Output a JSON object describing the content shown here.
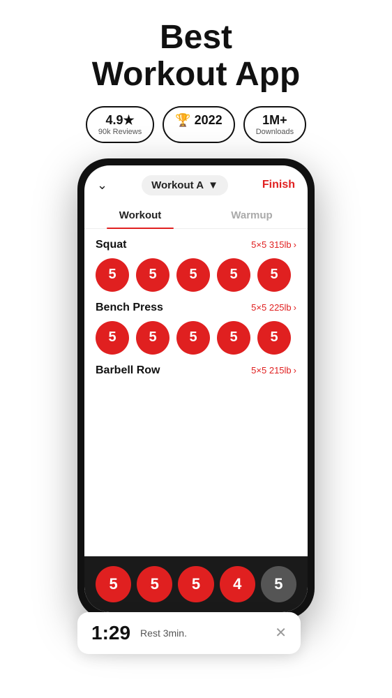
{
  "header": {
    "title_line1": "Best",
    "title_line2": "Workout App"
  },
  "badges": [
    {
      "main": "4.9★",
      "sub": "90k Reviews"
    },
    {
      "main": "🏆 2022",
      "sub": ""
    },
    {
      "main": "1M+",
      "sub": "Downloads"
    }
  ],
  "app": {
    "workout_name": "Workout A",
    "finish_label": "Finish",
    "tabs": [
      "Workout",
      "Warmup"
    ],
    "active_tab": 0
  },
  "exercises": [
    {
      "name": "Squat",
      "stats": "5×5 315lb",
      "sets": [
        5,
        5,
        5,
        5,
        5
      ],
      "active_count": 5
    },
    {
      "name": "Bench Press",
      "stats": "5×5 225lb",
      "sets": [
        5,
        5,
        5,
        5,
        5
      ],
      "active_count": 5
    },
    {
      "name": "Barbell Row",
      "stats": "5×5 215lb",
      "sets": [],
      "active_count": 0
    }
  ],
  "bottom_bar": {
    "sets": [
      5,
      5,
      5,
      4,
      5
    ],
    "active_count": 4
  },
  "rest_timer": {
    "time": "1:29",
    "label": "Rest 3min."
  }
}
